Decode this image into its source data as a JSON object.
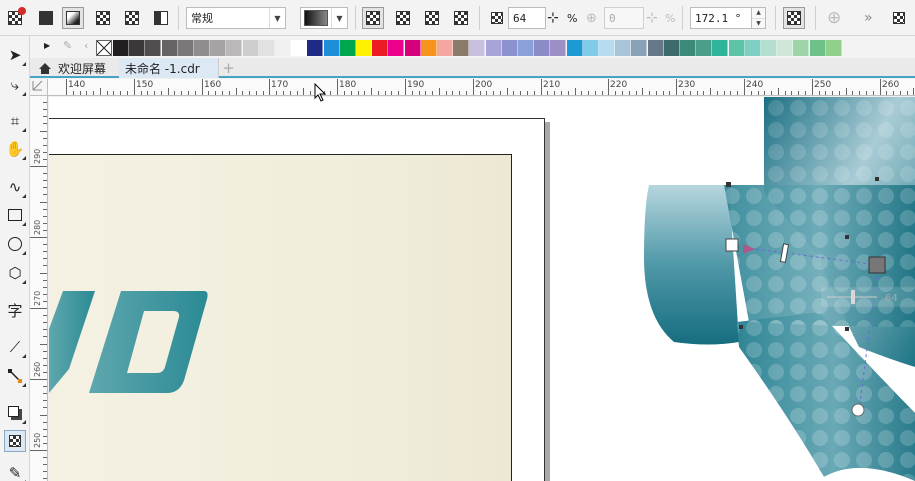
{
  "property_bar": {
    "blend_mode": "常规",
    "transparency_value": "64",
    "percent_sign": "%",
    "disabled_value": "0",
    "angle_value": "172.1 °",
    "overflow_chevron": "»"
  },
  "palette": {
    "colors": [
      "#231f20",
      "#3b3839",
      "#514e4f",
      "#666364",
      "#7b7879",
      "#908d8e",
      "#a5a3a4",
      "#bab8b9",
      "#cfcecf",
      "#e2e1e1",
      "#f0f0f0",
      "#ffffff",
      "#1f2a86",
      "#1d8fd8",
      "#00a650",
      "#fff200",
      "#ed1c24",
      "#ec008c",
      "#d6007a",
      "#f7941d",
      "#f6a6a1",
      "#8a7a6a",
      "#c9c0e0",
      "#a6a3d6",
      "#8c92cd",
      "#8aa0d8",
      "#8b8bc8",
      "#9c8fc6",
      "#1c9ad6",
      "#7fcbe8",
      "#b8dcef",
      "#a8c5d8",
      "#8aa2b8",
      "#67788a",
      "#3d6b6b",
      "#3b8a7a",
      "#4a9e8a",
      "#2fb69a",
      "#5ec4a8",
      "#7fd0c2",
      "#b4dfcf",
      "#cfe7d8",
      "#9fd3a8",
      "#6fc18a",
      "#8fd08a"
    ]
  },
  "tabs": {
    "home_label": "欢迎屏幕",
    "document_label": "未命名 -1.cdr",
    "add_label": "+"
  },
  "hruler": {
    "labels": [
      "140",
      "150",
      "160",
      "170",
      "180",
      "190",
      "200",
      "210",
      "220",
      "230",
      "240",
      "250",
      "260"
    ]
  },
  "vruler": {
    "labels": [
      "290",
      "280",
      "270",
      "260",
      "250"
    ]
  },
  "canvas": {
    "artwork_text": "JD",
    "slider_value": "64"
  },
  "colors": {
    "accent": "#4aa3c6",
    "teal_dark": "#1e7384",
    "teal_light": "#a9cfd8"
  }
}
